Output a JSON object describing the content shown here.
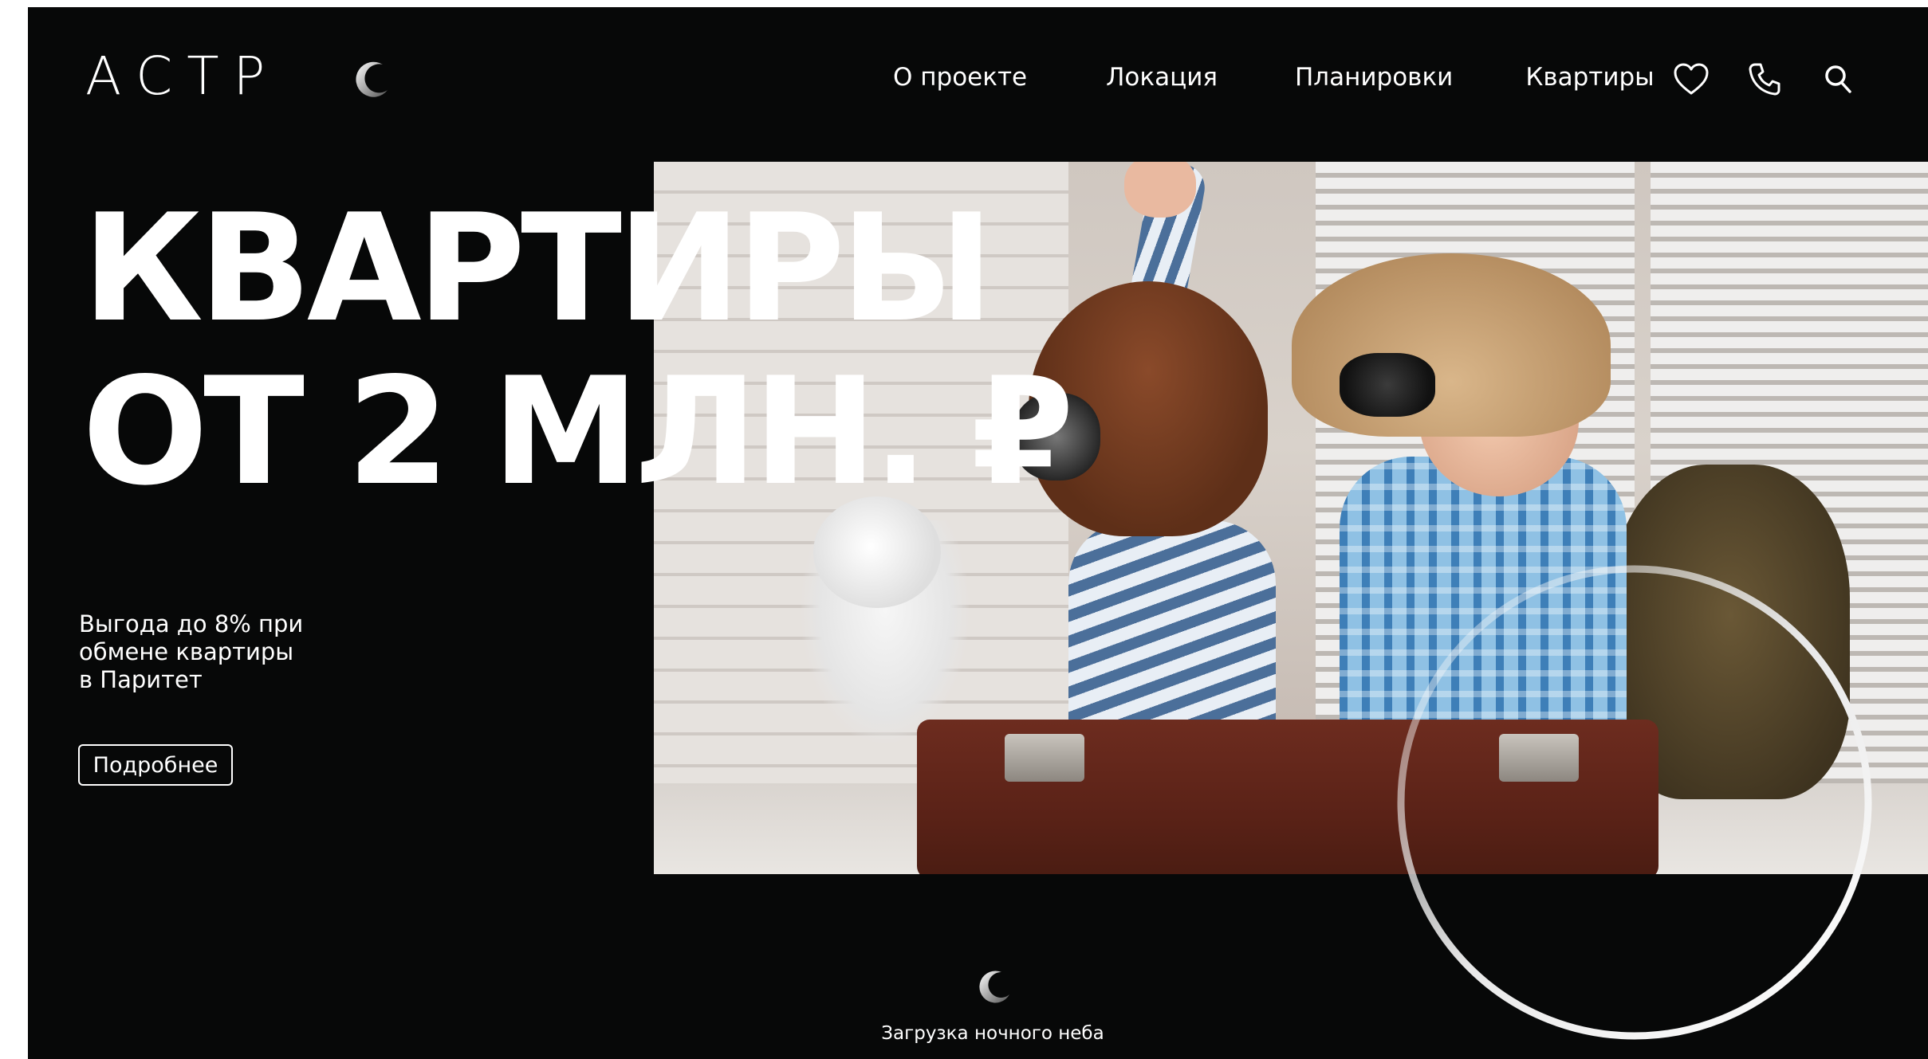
{
  "header": {
    "logo_text": "АСТР",
    "nav": [
      {
        "label": "О проекте"
      },
      {
        "label": "Локация"
      },
      {
        "label": "Планировки"
      },
      {
        "label": "Квартиры"
      }
    ],
    "icons": [
      "heart-icon",
      "phone-icon",
      "search-icon"
    ]
  },
  "hero": {
    "headline_line1": "КВАРТИРЫ",
    "headline_line2": "ОТ 2 МЛН. ₽",
    "promo_line1": "Выгода до 8% при",
    "promo_line2": "обмене квартиры",
    "promo_line3": "в Паритет",
    "button_label": "Подробнее"
  },
  "loader": {
    "text": "Загрузка ночного неба"
  },
  "colors": {
    "background": "#070808",
    "text": "#ffffff"
  }
}
